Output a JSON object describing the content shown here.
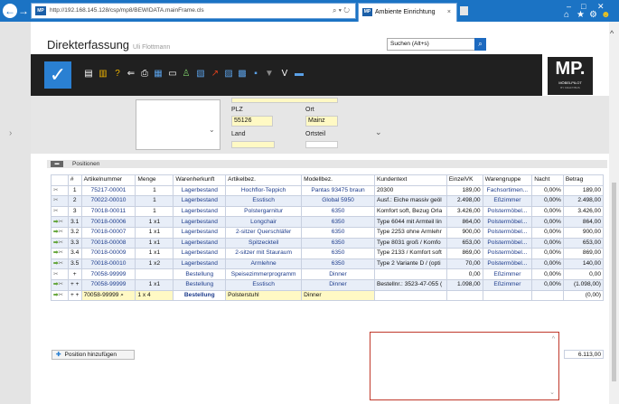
{
  "browser": {
    "url": "http://192.168.145.128/csp/mp8/BEWIDATA.mainFrame.cls",
    "tab_title": "Ambiente Einrichtung",
    "tab_close": "×",
    "tab_favicon": "MP",
    "url_favicon": "MP"
  },
  "app": {
    "title": "Direkterfassung",
    "subtitle": "Uli Flottmann",
    "search_placeholder": "Suchen (Alt+s)",
    "logo_text": "MP.",
    "logo_sub": "MÖBELPILOT",
    "logo_sub2": "BY KRAFT/BUS"
  },
  "address_form": {
    "plz_label": "PLZ",
    "plz_value": "55126",
    "ort_label": "Ort",
    "ort_value": "Mainz",
    "land_label": "Land",
    "ortsteil_label": "Ortsteil"
  },
  "positions": {
    "section_label": "Positionen",
    "columns": [
      "",
      "#",
      "Artikelnummer",
      "Menge",
      "Warenherkunft",
      "Artikelbez.",
      "Modellbez.",
      "Kundentext",
      "EinzelVK",
      "Warengruppe",
      "Nacht",
      "Betrag"
    ],
    "rows": [
      {
        "nr": "1",
        "art": "75217-00001",
        "menge": "1",
        "herkunft": "Lagerbestand",
        "bez": "Hochflor-Teppich",
        "modell": "Pantas 93475 braun",
        "text": "20300",
        "vk": "189,00",
        "gruppe": "Fachsortimen...",
        "nacht": "0,00%",
        "betrag": "189,00"
      },
      {
        "nr": "2",
        "art": "70022-00010",
        "menge": "1",
        "herkunft": "Lagerbestand",
        "bez": "Esstisch",
        "modell": "Global 5950",
        "text": "Ausf.: Eiche massiv geöl",
        "vk": "2.498,00",
        "gruppe": "Eßzimmer",
        "nacht": "0,00%",
        "betrag": "2.498,00"
      },
      {
        "nr": "3",
        "art": "70018-00011",
        "menge": "1",
        "herkunft": "Lagerbestand",
        "bez": "Polstergarnitur",
        "modell": "6350",
        "text": "Komfort soft, Bezug Orla",
        "vk": "3.426,00",
        "gruppe": "Polstermöbel...",
        "nacht": "0,00%",
        "betrag": "3.426,00"
      },
      {
        "nr": "3.1",
        "art": "70018-00006",
        "menge": "1 x1",
        "herkunft": "Lagerbestand",
        "bez": "Longchair",
        "modell": "6350",
        "text": "Type 6044 mit Armteil lin",
        "vk": "864,00",
        "gruppe": "Polstermöbel...",
        "nacht": "0,00%",
        "betrag": "864,00"
      },
      {
        "nr": "3.2",
        "art": "70018-00007",
        "menge": "1 x1",
        "herkunft": "Lagerbestand",
        "bez": "2-sitzer Querschläfer",
        "modell": "6350",
        "text": "Type 2253 ohne Armlehr",
        "vk": "900,00",
        "gruppe": "Polstermöbel...",
        "nacht": "0,00%",
        "betrag": "900,00"
      },
      {
        "nr": "3.3",
        "art": "70018-00008",
        "menge": "1 x1",
        "herkunft": "Lagerbestand",
        "bez": "Spitzeckteil",
        "modell": "6350",
        "text": "Type 8031 groß / Komfo",
        "vk": "653,00",
        "gruppe": "Polstermöbel...",
        "nacht": "0,00%",
        "betrag": "653,00"
      },
      {
        "nr": "3.4",
        "art": "70018-00009",
        "menge": "1 x1",
        "herkunft": "Lagerbestand",
        "bez": "2-sitzer mit Stauraum",
        "modell": "6350",
        "text": "Type 2133 / Komfort soft",
        "vk": "869,00",
        "gruppe": "Polstermöbel...",
        "nacht": "0,00%",
        "betrag": "869,00"
      },
      {
        "nr": "3.5",
        "art": "70018-00010",
        "menge": "1 x2",
        "herkunft": "Lagerbestand",
        "bez": "Armlehne",
        "modell": "6350",
        "text": "Type 2 Variante D / (opti",
        "vk": "70,00",
        "gruppe": "Polstermöbel...",
        "nacht": "0,00%",
        "betrag": "140,00"
      },
      {
        "nr": "+",
        "art": "70058-99999",
        "menge": "",
        "herkunft": "Bestellung",
        "bez": "Speisezimmerprogramm",
        "modell": "Dinner",
        "text": "",
        "vk": "0,00",
        "gruppe": "Eßzimmer",
        "nacht": "0,00%",
        "betrag": "0,00"
      },
      {
        "nr": "+ +",
        "art": "70058-99999",
        "menge": "1 x1",
        "herkunft": "Bestellung",
        "bez": "Esstisch",
        "modell": "Dinner",
        "text": "Bestellnr.: 3523-47-055 (",
        "vk": "1.098,00",
        "gruppe": "Eßzimmer",
        "nacht": "0,00%",
        "betrag": "(1.098,00)"
      }
    ],
    "edit_row": {
      "nr": "+ +",
      "art": "70058-99999",
      "menge_prefix": "1 x",
      "menge_value": "4",
      "herkunft": "Bestellung",
      "bez": "Polsterstuhl",
      "modell": "Dinner",
      "betrag": "(0,00)"
    },
    "add_label": "Position hinzufügen",
    "total": "6.113,00"
  }
}
